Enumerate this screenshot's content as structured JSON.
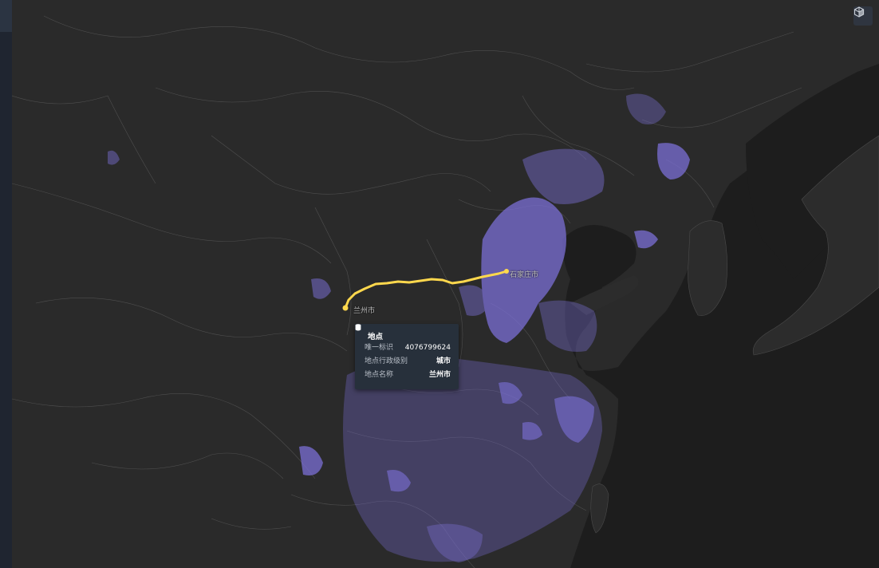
{
  "map": {
    "route": {
      "color": "#ffd84d",
      "from": "兰州市",
      "to": "石家庄市"
    },
    "highlight_color": "#7b6fd6",
    "background_color": "#262626"
  },
  "labels": {
    "lanzhou": "兰州市",
    "shijiazhuang": "石家庄市"
  },
  "popup": {
    "title": "地点",
    "rows": [
      {
        "key": "唯一标识",
        "value": "4076799624"
      },
      {
        "key": "地点行政级别",
        "value": "城市"
      },
      {
        "key": "地点名称",
        "value": "兰州市"
      }
    ]
  },
  "controls": {
    "icon": "3d-view-icon"
  }
}
